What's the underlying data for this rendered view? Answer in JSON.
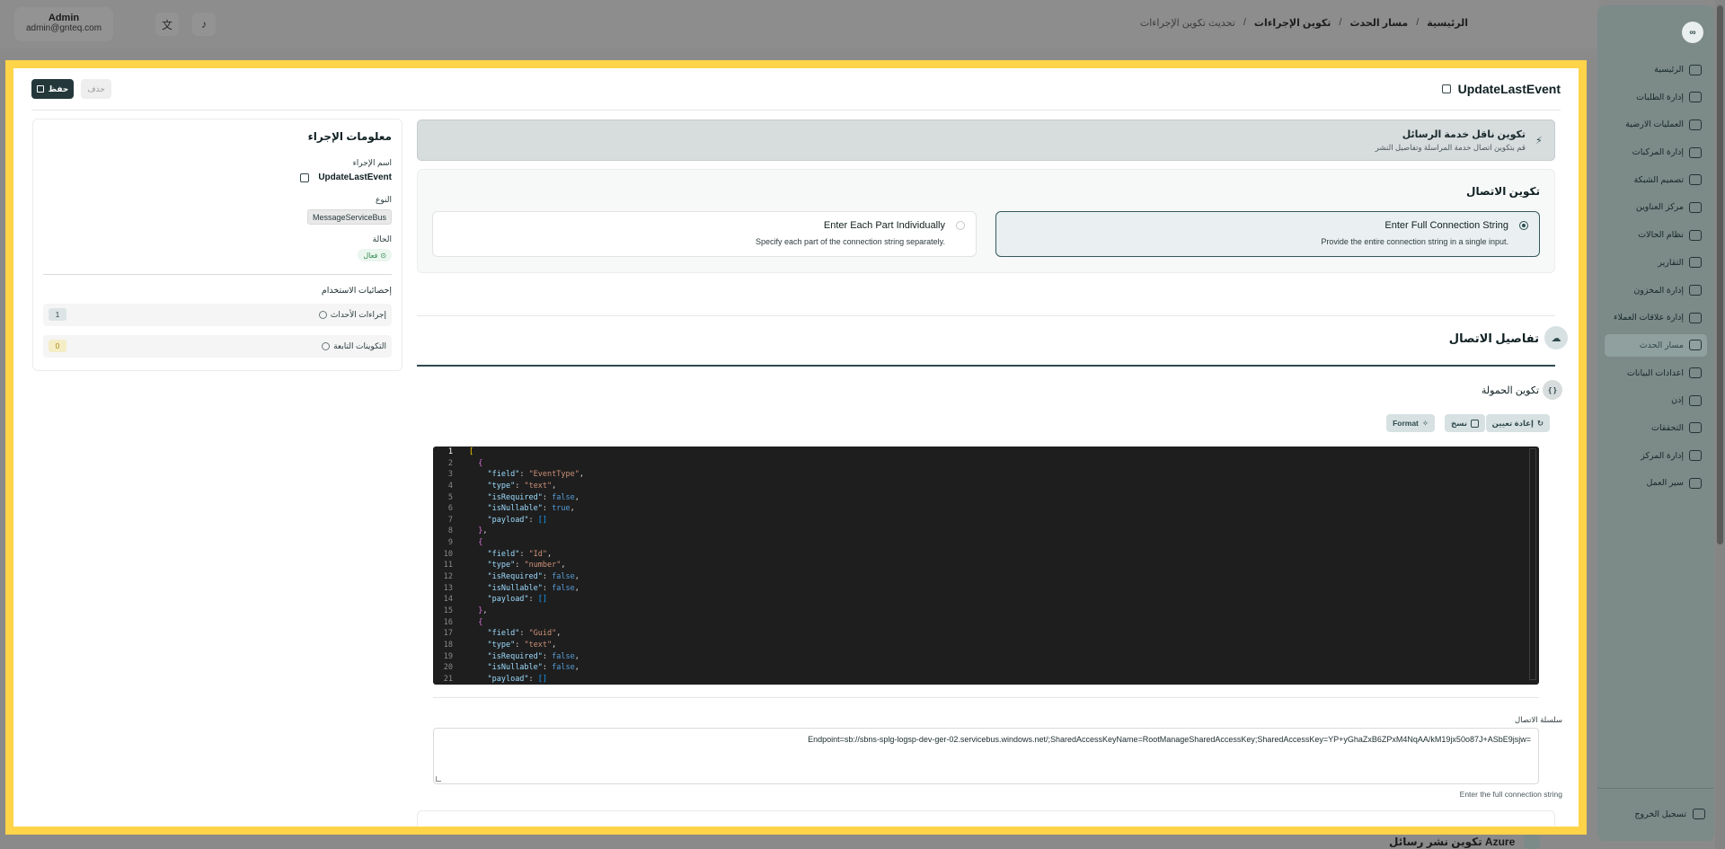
{
  "topbar": {
    "user_name": "Admin",
    "user_email": "admin@gnteq.com",
    "breadcrumb": [
      "الرئيسية",
      "مسار الحدث",
      "تكوين الإجراءات",
      "تحديث تكوين الإجراءات"
    ]
  },
  "sidebar": {
    "logo": "∞",
    "items": [
      {
        "label": "الرئيسية",
        "icon": "dashboard-icon"
      },
      {
        "label": "إدارة الطلبات",
        "icon": "orders-icon"
      },
      {
        "label": "العمليات الارضية",
        "icon": "ground-ops-icon"
      },
      {
        "label": "إدارة المركبات",
        "icon": "truck-icon"
      },
      {
        "label": "تصميم الشبكة",
        "icon": "network-icon"
      },
      {
        "label": "مركز العناوين",
        "icon": "address-icon"
      },
      {
        "label": "نظام الحالات",
        "icon": "status-icon"
      },
      {
        "label": "التقارير",
        "icon": "reports-icon"
      },
      {
        "label": "إدارة المخزون",
        "icon": "inventory-icon"
      },
      {
        "label": "إدارة علاقات العملاء",
        "icon": "crm-icon"
      },
      {
        "label": "مسار الحدث",
        "icon": "event-flow-icon",
        "active": true
      },
      {
        "label": "اعدادات البيانات",
        "icon": "database-icon"
      },
      {
        "label": "إذن",
        "icon": "permission-icon"
      },
      {
        "label": "التحققات",
        "icon": "validation-icon"
      },
      {
        "label": "إدارة المركز",
        "icon": "hub-icon"
      },
      {
        "label": "سير العمل",
        "icon": "workflow-icon"
      }
    ],
    "logout": "تسجيل الخروج"
  },
  "page": {
    "title": "UpdateLastEvent",
    "save": "حفظ",
    "delete": "حذف"
  },
  "info": {
    "title": "معلومات الإجراء",
    "name_label": "اسم الإجراء",
    "name_value": "UpdateLastEvent",
    "type_label": "النوع",
    "type_value": "MessageServiceBus",
    "status_label": "الحالة",
    "status_value": "فعال",
    "stats_title": "إحصائيات الاستخدام",
    "stats": [
      {
        "label": "إجراءات الأحداث",
        "count": "1"
      },
      {
        "label": "التكوينات التابعة",
        "count": "0"
      }
    ]
  },
  "banner": {
    "title": "تكوين ناقل خدمة الرسائل",
    "subtitle": "قم بتكوين اتصال خدمة المراسلة وتفاصيل النشر"
  },
  "connection": {
    "title": "تكوين الاتصال",
    "options": [
      {
        "title": "Enter Full Connection String",
        "subtitle": "Provide the entire connection string in a single input.",
        "selected": true
      },
      {
        "title": "Enter Each Part Individually",
        "subtitle": "Specify each part of the connection string separately.",
        "selected": false
      }
    ]
  },
  "details": {
    "title": "تفاصيل الاتصال",
    "payload_title": "تكوين الحمولة",
    "payload_icon": "{ }",
    "buttons": {
      "reset": "إعادة تعيين",
      "copy": "نسخ",
      "format": "Format"
    }
  },
  "editor_lines": [
    "[",
    "  {",
    "    \"field\": \"EventType\",",
    "    \"type\": \"text\",",
    "    \"isRequired\": false,",
    "    \"isNullable\": true,",
    "    \"payload\": []",
    "  },",
    "  {",
    "    \"field\": \"Id\",",
    "    \"type\": \"number\",",
    "    \"isRequired\": false,",
    "    \"isNullable\": false,",
    "    \"payload\": []",
    "  },",
    "  {",
    "    \"field\": \"Guid\",",
    "    \"type\": \"text\",",
    "    \"isRequired\": false,",
    "    \"isNullable\": false,",
    "    \"payload\": []"
  ],
  "connection_string": {
    "label": "سلسلة الاتصال",
    "value": "Endpoint=sb://sbns-splg-logsp-dev-ger-02.servicebus.windows.net/;SharedAccessKeyName=RootManageSharedAccessKey;SharedAccessKey=YP+yGhaZxB6ZPxM4NqAA/kM19jx50o87J+ASbE9jsjw=",
    "help": "Enter the full connection string"
  },
  "behind": {
    "section_title": "تكوين نشر رسائل Azure"
  }
}
